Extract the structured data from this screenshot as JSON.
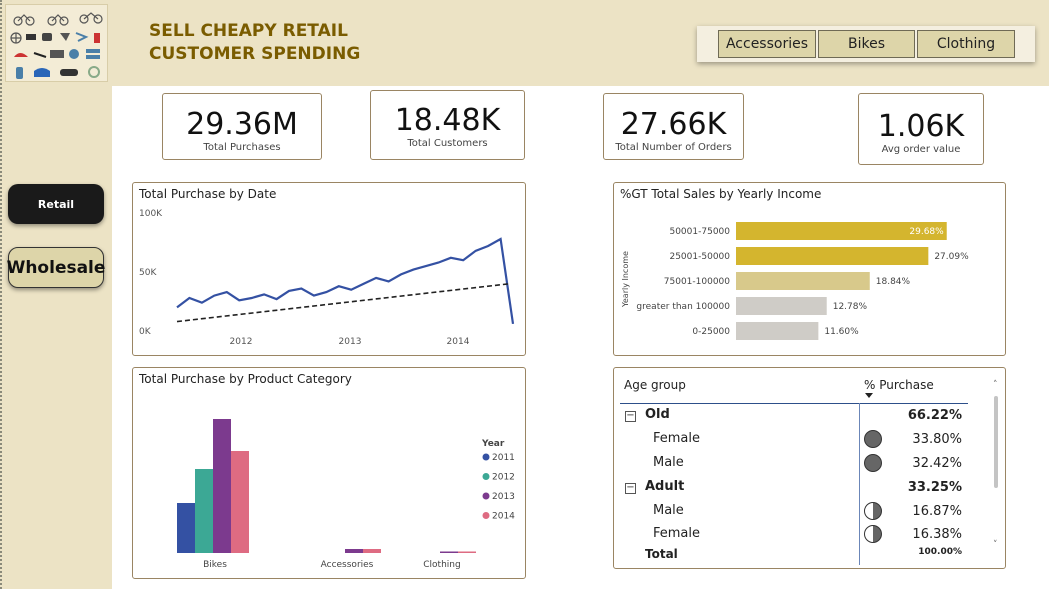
{
  "header": {
    "title_line1": "SELL CHEAPY RETAIL",
    "title_line2": "CUSTOMER SPENDING"
  },
  "slicer": {
    "options": [
      "Accessories",
      "Bikes",
      "Clothing"
    ]
  },
  "nav": {
    "retail": "Retail",
    "wholesale": "Wholesale"
  },
  "kpis": [
    {
      "value": "29.36M",
      "label": "Total Purchases"
    },
    {
      "value": "18.48K",
      "label": "Total Customers"
    },
    {
      "value": "27.66K",
      "label": "Total Number of Orders"
    },
    {
      "value": "1.06K",
      "label": "Avg order value"
    }
  ],
  "colors": {
    "band": "#ece3c5",
    "gold": "#d4b52e",
    "tan": "#d8c98b",
    "grey": "#cfccc7",
    "line": "#3451a3",
    "c2011": "#3451a3",
    "c2012": "#3ca895",
    "c2013": "#7c3a8e",
    "c2014": "#de6b82"
  },
  "chart_data": [
    {
      "type": "line",
      "title": "Total Purchase by Date",
      "x_ticks": [
        "2012",
        "2013",
        "2014"
      ],
      "y_ticks": [
        "0K",
        "50K",
        "100K"
      ],
      "ylim": [
        0,
        100000
      ],
      "series": [
        {
          "values": [
            20000,
            28000,
            24000,
            30000,
            33000,
            26000,
            28000,
            31000,
            27000,
            34000,
            36000,
            30000,
            33000,
            38000,
            35000,
            40000,
            45000,
            42000,
            48000,
            52000,
            55000,
            58000,
            62000,
            60000,
            68000,
            72000,
            78000,
            6000
          ]
        },
        {
          "values": [
            8000,
            40000
          ]
        }
      ]
    },
    {
      "type": "bar",
      "title": "%GT Total Sales by Yearly Income",
      "ylabel": "Yearly Income",
      "categories": [
        "50001-75000",
        "25001-50000",
        "75001-100000",
        "greater than 100000",
        "0-25000"
      ],
      "values": [
        29.68,
        27.09,
        18.84,
        12.78,
        11.6
      ],
      "labels": [
        "29.68%",
        "27.09%",
        "18.84%",
        "12.78%",
        "11.60%"
      ]
    },
    {
      "type": "bar",
      "title": "Total Purchase by Product Category",
      "categories": [
        "Bikes",
        "Accessories",
        "Clothing"
      ],
      "legend_title": "Year",
      "series": [
        {
          "name": "2011",
          "values": [
            100,
            0,
            0
          ]
        },
        {
          "name": "2012",
          "values": [
            168,
            0,
            0
          ]
        },
        {
          "name": "2013",
          "values": [
            268,
            8,
            3
          ]
        },
        {
          "name": "2014",
          "values": [
            204,
            8,
            3
          ]
        }
      ]
    },
    {
      "type": "table",
      "columns": [
        "Age group",
        "% Purchase"
      ],
      "rows": [
        {
          "label": "Old",
          "value": "66.22%"
        },
        {
          "label": "Female",
          "value": "33.80%"
        },
        {
          "label": "Male",
          "value": "32.42%"
        },
        {
          "label": "Adult",
          "value": "33.25%"
        },
        {
          "label": "Male",
          "value": "16.87%"
        },
        {
          "label": "Female",
          "value": "16.38%"
        },
        {
          "label": "Total",
          "value": "100.00%"
        }
      ]
    }
  ]
}
